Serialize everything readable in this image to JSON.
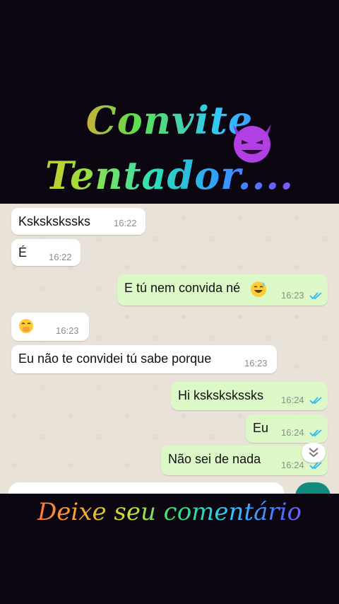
{
  "header": {
    "title_line1": "Convite",
    "title_line2": "Tentador....",
    "emoji": "smiling-devil"
  },
  "messages": [
    {
      "dir": "in",
      "text": "Kskskskssks",
      "time": "16:22"
    },
    {
      "dir": "in",
      "text": "É",
      "time": "16:22"
    },
    {
      "dir": "out",
      "text": "E tú nem convida né",
      "emoji": "grinning-sweat",
      "time": "16:23",
      "status": "read"
    },
    {
      "dir": "in",
      "text": "",
      "emoji": "hand-over-mouth",
      "time": "16:23"
    },
    {
      "dir": "in",
      "text": "Eu não te convidei tú sabe porque",
      "time": "16:23"
    },
    {
      "dir": "out",
      "text": "Hi kskskskssks",
      "time": "16:24",
      "status": "read"
    },
    {
      "dir": "out",
      "text": "Eu",
      "time": "16:24",
      "status": "read"
    },
    {
      "dir": "out",
      "text": "Não sei de nada",
      "time": "16:24",
      "status": "read"
    }
  ],
  "footer": {
    "text": "Deixe seu comentário"
  },
  "colors": {
    "incoming_bubble": "#ffffff",
    "outgoing_bubble": "#dcf8c6",
    "read_ticks": "#34b7f1",
    "send_button": "#128c7e"
  }
}
